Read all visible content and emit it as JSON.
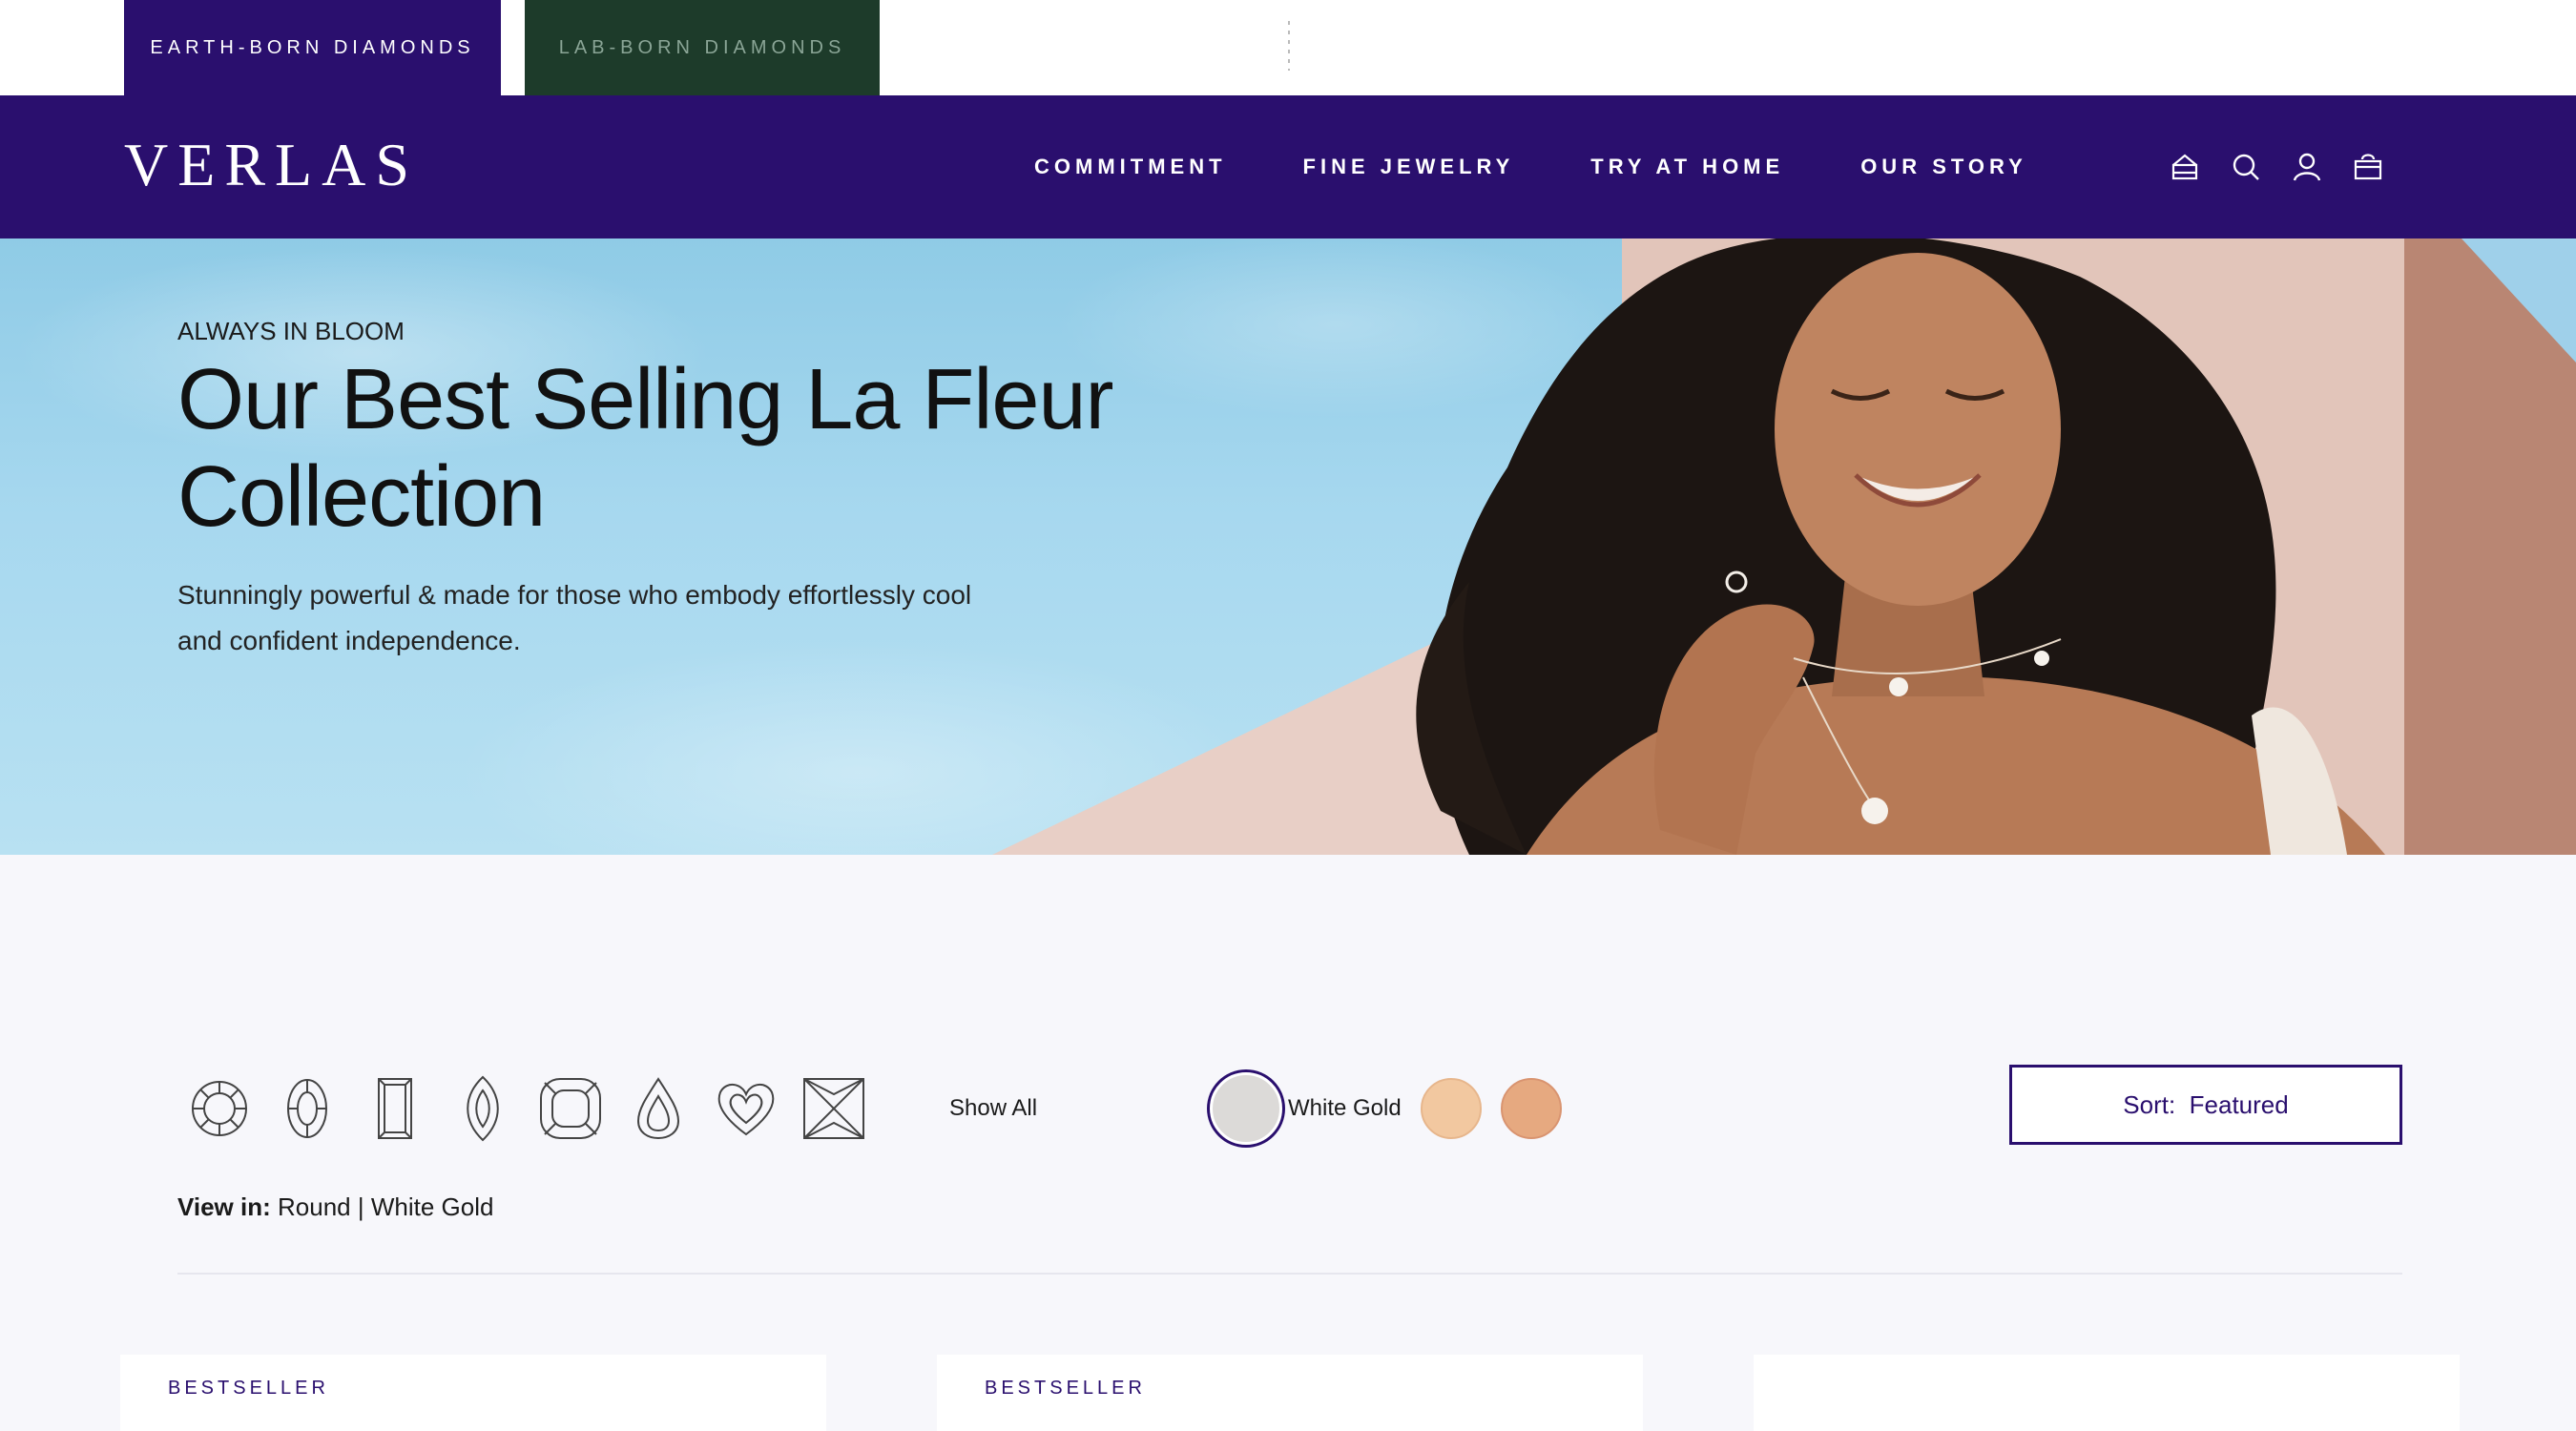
{
  "topbar": {
    "tabs": [
      {
        "label": "EARTH-BORN DIAMONDS",
        "active": true
      },
      {
        "label": "LAB-BORN DIAMONDS",
        "active": false
      }
    ]
  },
  "nav": {
    "logo": "VERLAS",
    "links": [
      "COMMITMENT",
      "FINE JEWELRY",
      "TRY AT HOME",
      "OUR STORY"
    ],
    "icons": [
      "store-icon",
      "search-icon",
      "account-icon",
      "bag-icon"
    ]
  },
  "hero": {
    "eyebrow": "ALWAYS IN BLOOM",
    "title_line1": "Our Best Selling La Fleur",
    "title_line2": "Collection",
    "subtitle_line1": "Stunningly powerful & made for those who embody effortlessly cool",
    "subtitle_line2": "and confident independence."
  },
  "filters": {
    "shapes": [
      "round",
      "oval",
      "emerald",
      "marquise",
      "cushion",
      "pear",
      "heart",
      "princess"
    ],
    "show_all": "Show All",
    "metals": [
      {
        "name": "White Gold",
        "color": "#dcdad8",
        "selected": true
      },
      {
        "name": "Yellow Gold",
        "color": "#f2c8a0",
        "selected": false
      },
      {
        "name": "Rose Gold",
        "color": "#e6a980",
        "selected": false
      }
    ],
    "selected_metal_label": "White Gold",
    "sort_label": "Sort:",
    "sort_value": "Featured",
    "view_in_label": "View in:",
    "view_in_value": "Round | White Gold"
  },
  "products": [
    {
      "badge": "BESTSELLER"
    },
    {
      "badge": "BESTSELLER"
    },
    {
      "badge": ""
    }
  ],
  "colors": {
    "brand": "#2a0f6e",
    "lab_tab": "#1d3b2a",
    "sky": "#a7d8ef"
  }
}
